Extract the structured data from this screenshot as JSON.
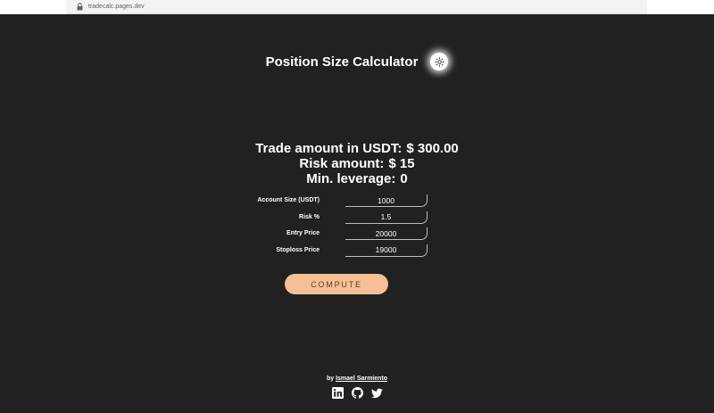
{
  "browser": {
    "url": "tradecalc.pages.dev"
  },
  "header": {
    "title": "Position Size Calculator",
    "theme_icon": "sun-icon"
  },
  "results": {
    "trade_amount_label": "Trade amount in USDT:",
    "trade_amount_value": "$ 300.00",
    "risk_amount_label": "Risk amount:",
    "risk_amount_value": "$ 15",
    "min_leverage_label": "Min. leverage:",
    "min_leverage_value": "0"
  },
  "form": {
    "fields": [
      {
        "label": "Account Size (USDT)",
        "value": "1000"
      },
      {
        "label": "Risk %",
        "value": "1.5"
      },
      {
        "label": "Entry Price",
        "value": "20000"
      },
      {
        "label": "Stoploss Price",
        "value": "19000"
      }
    ],
    "compute_label": "COMPUTE"
  },
  "footer": {
    "by_text": "by",
    "author": "Ismael Sarmiento",
    "socials": [
      "linkedin-icon",
      "github-icon",
      "twitter-icon"
    ]
  },
  "colors": {
    "background": "#212121",
    "accent": "#f6bf95",
    "text": "#ffffff"
  }
}
